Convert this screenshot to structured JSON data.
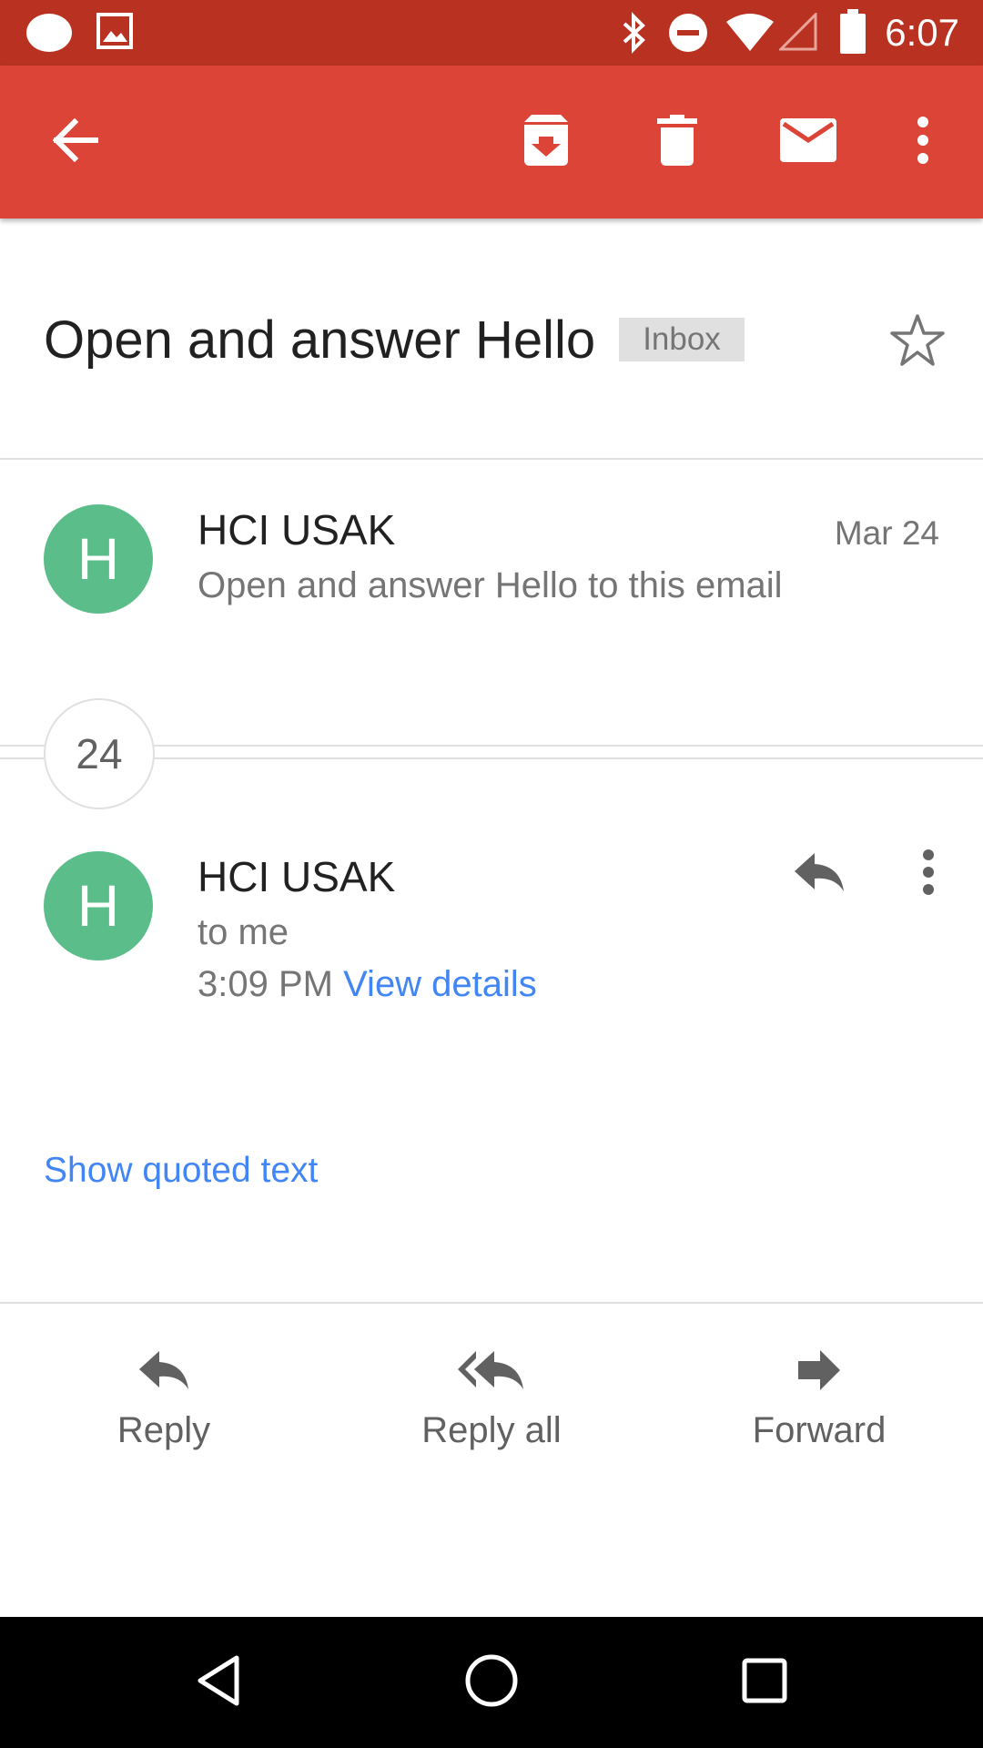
{
  "status_bar": {
    "time": "6:07",
    "icons": [
      "notification-dot-icon",
      "image-icon",
      "bluetooth-icon",
      "do-not-disturb-icon",
      "wifi-icon",
      "signal-icon",
      "battery-icon"
    ]
  },
  "app_bar": {
    "icons": [
      "back-arrow-icon",
      "archive-icon",
      "delete-icon",
      "mark-unread-icon",
      "more-vert-icon"
    ],
    "color": "#db4437"
  },
  "thread": {
    "subject": "Open and answer Hello",
    "label": "Inbox"
  },
  "message1": {
    "avatar_letter": "H",
    "sender": "HCI USAK",
    "snippet": "Open and answer Hello to this email",
    "date": "Mar 24"
  },
  "collapsed_count": "24",
  "message2": {
    "avatar_letter": "H",
    "sender": "HCI USAK",
    "recipient": "to me",
    "time": "3:09 PM",
    "view_details": "View details",
    "show_quoted": "Show quoted text"
  },
  "actions": {
    "reply": "Reply",
    "reply_all": "Reply all",
    "forward": "Forward"
  },
  "colors": {
    "accent_link": "#4285f4",
    "avatar": "#5bbd8a",
    "status_bar": "#b93221"
  }
}
